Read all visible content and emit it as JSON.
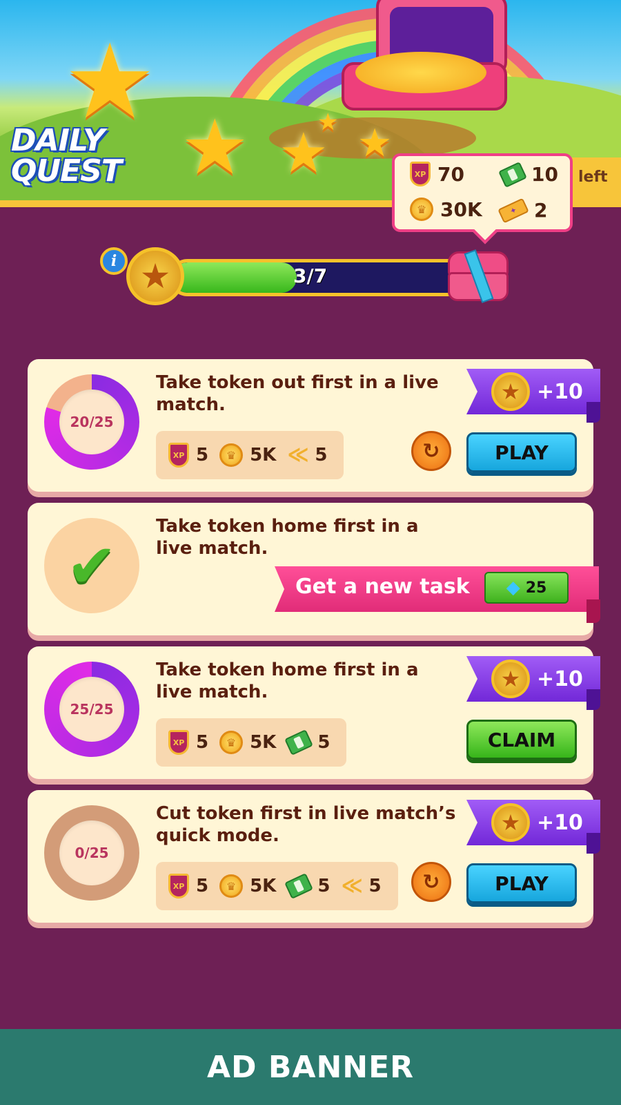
{
  "header": {
    "title_line1": "DAILY",
    "title_line2": "QUEST",
    "time_left_suffix": "left"
  },
  "reward_popup": {
    "xp_value": "70",
    "cash_value": "10",
    "coins_value": "30K",
    "ticket_value": "2"
  },
  "progress": {
    "label": "3/7",
    "completed": 3,
    "total": 7,
    "info_icon": "i"
  },
  "quests": [
    {
      "text": "Take token out first in a live match.",
      "progress_label": "20/25",
      "progress_fraction": 0.8,
      "rewards": {
        "xp": "5",
        "coins": "5K",
        "badge": "5"
      },
      "ribbon_reward": "+10",
      "action_label": "PLAY"
    },
    {
      "text": "Take token home first in a live match.",
      "status": "completed",
      "new_task_label": "Get a new task",
      "new_task_cost": "25"
    },
    {
      "text": "Take token home first in a live match.",
      "progress_label": "25/25",
      "progress_fraction": 1.0,
      "rewards": {
        "xp": "5",
        "coins": "5K",
        "cash": "5"
      },
      "ribbon_reward": "+10",
      "action_label": "CLAIM"
    },
    {
      "text": "Cut token first in live match’s quick mode.",
      "progress_label": "0/25",
      "progress_fraction": 0,
      "rewards": {
        "xp": "5",
        "coins": "5K",
        "cash": "5",
        "badge": "5"
      },
      "ribbon_reward": "+10",
      "action_label": "PLAY"
    }
  ],
  "ad_banner": {
    "label": "AD BANNER"
  },
  "icons": {
    "xp": "xp-shield-icon",
    "coin": "coin-icon",
    "cash": "cash-icon",
    "ticket": "ticket-icon",
    "badge": "rank-badge-icon",
    "gem": "gem-icon",
    "refresh": "refresh-icon",
    "star": "star-icon",
    "check": "checkmark-icon"
  },
  "colors": {
    "background": "#6e2055",
    "ribbon_purple": "#7228d8",
    "new_task_pink": "#e12c78",
    "play_blue": "#17a6dd",
    "claim_green": "#37b51a",
    "ring_magenta": "#e02be6",
    "ad_banner": "#2b7a6e"
  }
}
